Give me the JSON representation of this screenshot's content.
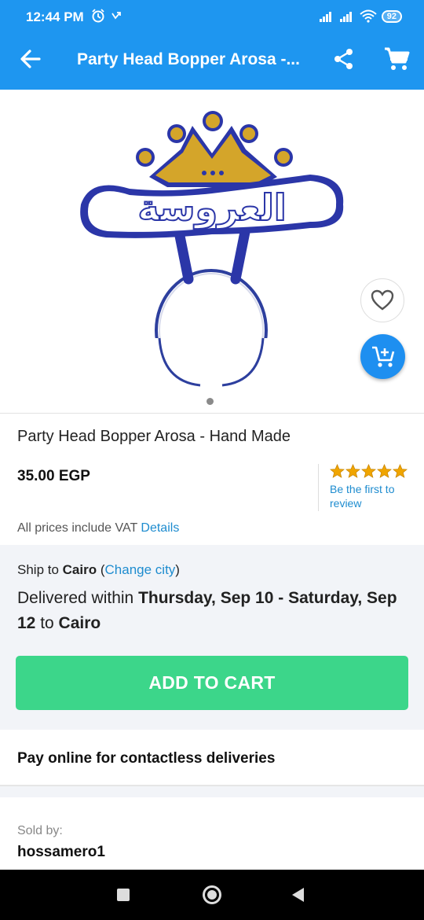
{
  "status_bar": {
    "time": "12:44 PM",
    "battery": "92",
    "icons_left": [
      "alarm-icon",
      "vpn-icon"
    ],
    "icons_right": [
      "signal-icon",
      "signal-icon",
      "wifi-icon",
      "battery-icon"
    ]
  },
  "app_bar": {
    "title": "Party Head Bopper Arosa -...",
    "back_icon": "arrow-back-icon",
    "share_icon": "share-icon",
    "cart_icon": "cart-icon",
    "background": "#1e96f0"
  },
  "product": {
    "image_alt_text": "العروسة",
    "title": "Party Head Bopper Arosa - Hand Made",
    "price": "35.00 EGP",
    "rating_stars": 5,
    "review_prompt": "Be the first to review",
    "vat_text": "All prices include VAT",
    "vat_link": "Details",
    "image_count": 1
  },
  "shipping": {
    "ship_to_prefix": "Ship to ",
    "city": "Cairo",
    "change_open": " (",
    "change_link": "Change city",
    "change_close": ")",
    "delivered_prefix": "Delivered within ",
    "delivery_range": "Thursday, Sep 10 - Saturday, Sep 12",
    "delivered_to": " to ",
    "delivered_city": "Cairo"
  },
  "actions": {
    "add_to_cart": "ADD TO CART",
    "add_to_cart_color": "#3cd68a"
  },
  "pay_online": {
    "text": "Pay online for contactless deliveries"
  },
  "seller": {
    "label": "Sold by:",
    "name": "hossamero1"
  },
  "colors": {
    "primary": "#1e96f0",
    "link": "#1e8ccf",
    "star": "#f0a500"
  }
}
